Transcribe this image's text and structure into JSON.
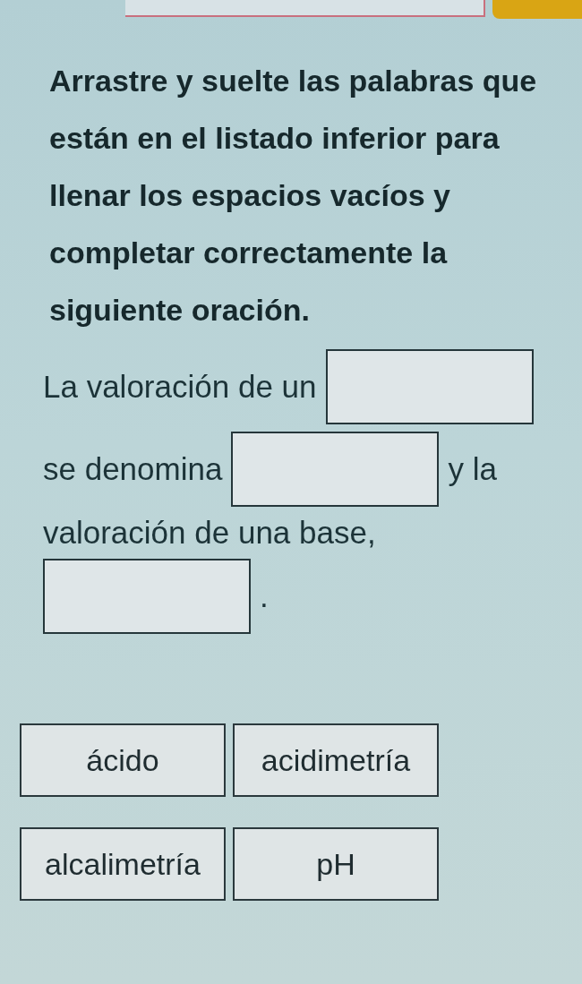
{
  "instructions": "Arrastre y suelte las palabras que están en el listado inferior para llenar los espacios vacíos y completar correctamente la siguiente oración.",
  "sentence": [
    {
      "kind": "text",
      "text": "La valoración de un"
    },
    {
      "kind": "blank"
    },
    {
      "kind": "text",
      "text": "se denomina"
    },
    {
      "kind": "blank"
    },
    {
      "kind": "text",
      "text": "y la"
    },
    {
      "kind": "text",
      "text": "valoración de una base,"
    },
    {
      "kind": "blank"
    },
    {
      "kind": "text",
      "text": "."
    }
  ],
  "word_bank": [
    "ácido",
    "acidimetría",
    "alcalimetría",
    "pH"
  ]
}
